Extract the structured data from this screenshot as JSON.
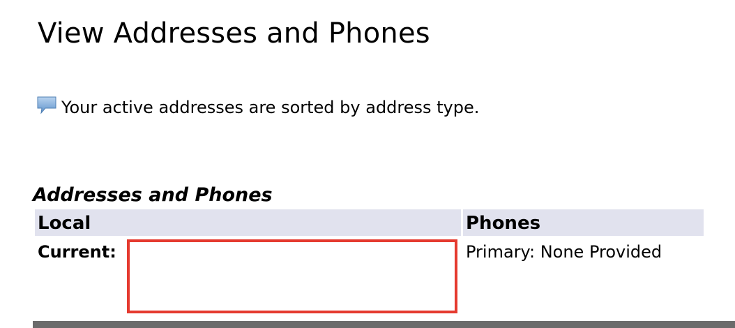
{
  "page": {
    "title": "View Addresses and Phones"
  },
  "info": {
    "icon": "speech-bubble-icon",
    "message": "Your active addresses are sorted by address type."
  },
  "section": {
    "caption": "Addresses and Phones",
    "columns": {
      "local": "Local",
      "phones": "Phones"
    },
    "rows": [
      {
        "label": "Current:",
        "phone": "Primary: None Provided"
      }
    ]
  },
  "colors": {
    "header_bg": "#e1e2ee",
    "redaction_border": "#e53a2f",
    "icon_blue": "#6fa2d6",
    "bottom_rule": "#6b6b6b"
  }
}
